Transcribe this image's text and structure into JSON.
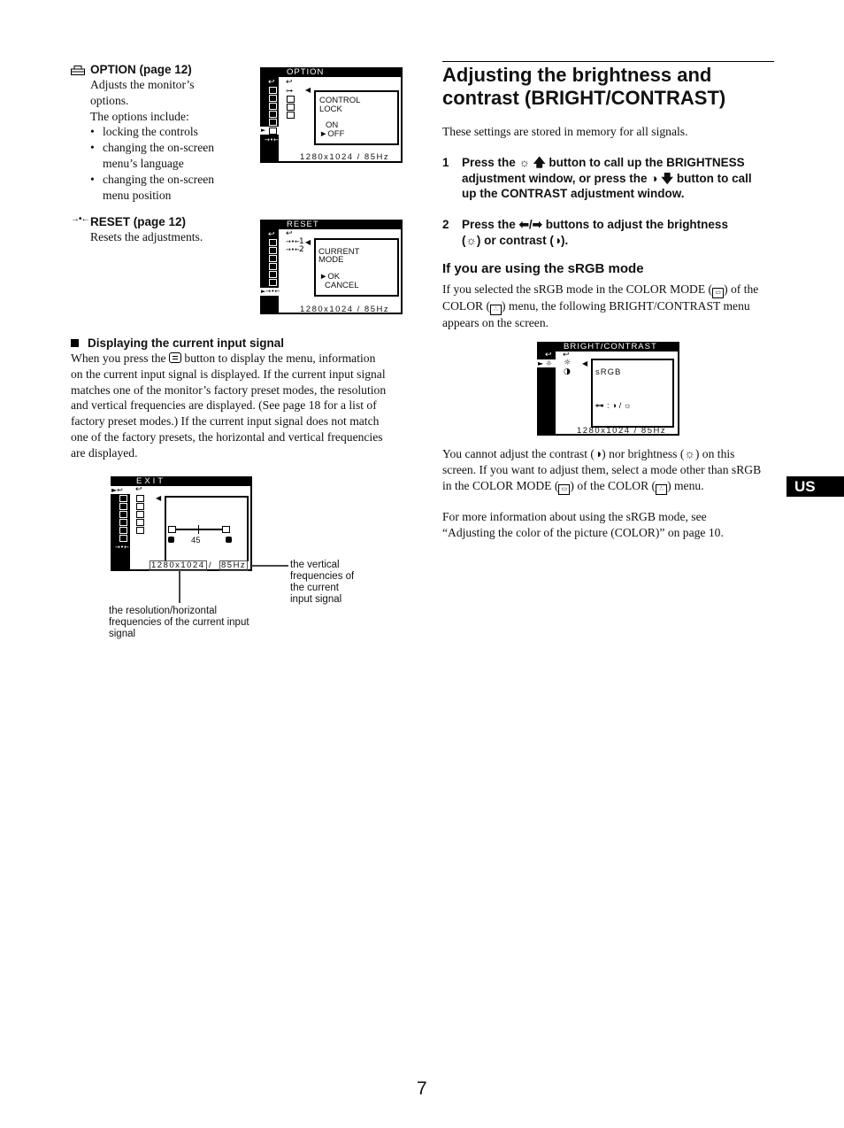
{
  "left": {
    "option": {
      "icon": "color-mode-icon",
      "heading": "OPTION (page 12)",
      "desc_1": "Adjusts the monitor’s",
      "desc_2": "options.",
      "desc_3": "The options include:",
      "bullets": [
        "locking the controls",
        "changing the on-screen",
        "menu’s language",
        "changing the on-screen",
        "menu position"
      ]
    },
    "reset": {
      "icon": "reset-icon",
      "heading": "RESET (page 12)",
      "desc": "Resets the adjustments."
    },
    "display_signal": {
      "heading": "Displaying the current input signal",
      "lines": [
        "When you press the",
        "button to display the menu, information",
        "on the current input signal is displayed. If the current input signal",
        "matches one of the monitor’s factory preset modes, the resolution",
        "and vertical frequencies are displayed. (See page 18 for a list of",
        "factory preset modes.) If the current input signal does not match",
        "one of the factory presets, the horizontal and vertical frequencies",
        "are displayed."
      ]
    }
  },
  "osd_option": {
    "title": "OPTION",
    "line1": "CONTROL",
    "line2": "LOCK",
    "opt1": "ON",
    "opt2": "►OFF",
    "res": "1280x1024 /  85Hz"
  },
  "osd_reset": {
    "title": "RESET",
    "item1": "1",
    "item2": "2",
    "line1": "CURRENT",
    "line2": "MODE",
    "opt1": "►OK",
    "opt2": "CANCEL",
    "res": "1280x1024 /  85Hz"
  },
  "osd_exit": {
    "title": "EXIT",
    "value": "45",
    "res_left": "1280x1024",
    "res_sep": "/",
    "res_right": "85Hz",
    "callout_right": [
      "the vertical",
      "frequencies of",
      "the current",
      "input signal"
    ],
    "callout_bottom": [
      "the resolution/horizontal",
      "frequencies of the current input",
      "signal"
    ]
  },
  "right": {
    "title_1": "Adjusting the brightness and",
    "title_2": "contrast (BRIGHT/CONTRAST)",
    "intro": "These settings are stored in memory for all signals.",
    "step1": {
      "num": "1",
      "a": "Press the",
      "b": "button to call up the BRIGHTNESS",
      "c": "adjustment window, or press the",
      "d": "button to call",
      "e": "up the CONTRAST adjustment window."
    },
    "step2": {
      "num": "2",
      "a": "Press the",
      "b": "buttons to adjust the brightness",
      "c": ") or contrast (",
      "d": ")."
    },
    "srgb_heading": "If you are using the sRGB mode",
    "srgb_p1_a": "If you selected the sRGB mode in the COLOR MODE (",
    "srgb_p1_b": ") of the",
    "srgb_p1_c": "COLOR (",
    "srgb_p1_d": ") menu, the following BRIGHT/CONTRAST menu",
    "srgb_p1_e": "appears on the screen.",
    "p2_a": "You cannot adjust the contrast (",
    "p2_b": ") nor brightness (",
    "p2_c": ") on this",
    "p2_d": "screen. If you want to adjust them, select a mode other than sRGB",
    "p2_e": "in the COLOR MODE (",
    "p2_f": ") of the COLOR (",
    "p2_g": ") menu.",
    "p3_a": "For more information about using the sRGB mode, see",
    "p3_b": "“Adjusting the color of the picture (COLOR)” on page 10."
  },
  "osd_bright": {
    "title": "BRIGHT/CONTRAST",
    "mode": "sRGB",
    "lock_line": ":  ◑  /  ☼",
    "res": "1280x1024 /  85Hz"
  },
  "lang_tab": "US",
  "page_number": "7"
}
